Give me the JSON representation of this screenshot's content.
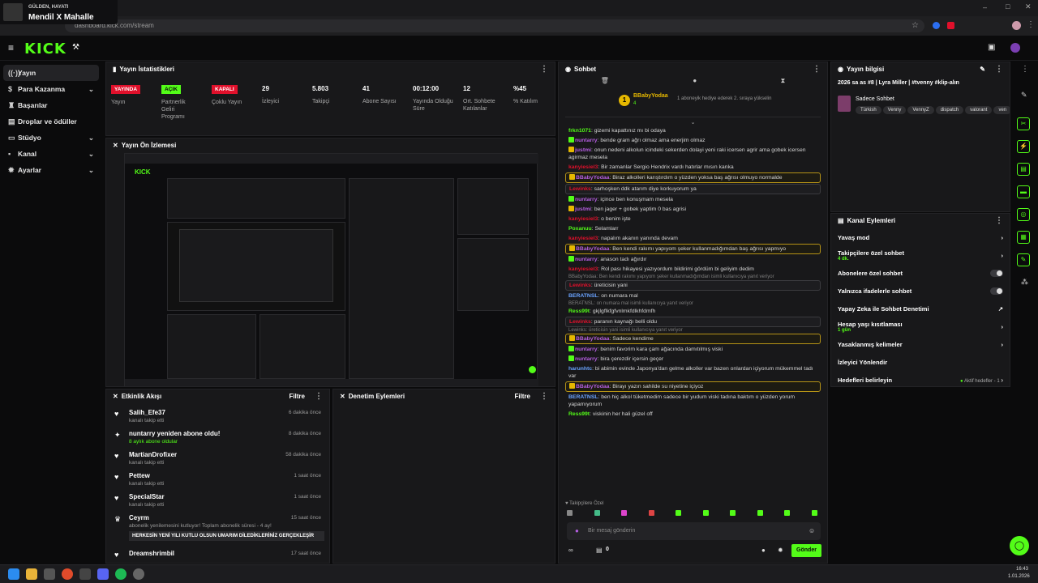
{
  "notification": {
    "title": "GÜLDEN, HAYATI",
    "subtitle": "Mendil X Mahalle"
  },
  "browser": {
    "url": "dashboard.kick.com/stream"
  },
  "app": {
    "logo": "KICK"
  },
  "sidebar": {
    "items": [
      {
        "label": "Yayın",
        "icon": "broadcast-icon",
        "active": true,
        "chevron": false
      },
      {
        "label": "Para Kazanma",
        "icon": "money-icon",
        "chevron": true
      },
      {
        "label": "Başarılar",
        "icon": "trophy-icon",
        "chevron": false
      },
      {
        "label": "Droplar ve ödüller",
        "icon": "gift-icon",
        "chevron": false
      },
      {
        "label": "Stüdyo",
        "icon": "studio-icon",
        "chevron": true
      },
      {
        "label": "Kanal",
        "icon": "user-icon",
        "chevron": true
      },
      {
        "label": "Ayarlar",
        "icon": "gear-icon",
        "chevron": true
      }
    ]
  },
  "stats": {
    "title": "Yayın İstatistikleri",
    "items": [
      {
        "value": "YAYINDA",
        "label": "Yayın",
        "badge": "red"
      },
      {
        "value": "AÇIK",
        "label": "Partnerlik Geliri Programı",
        "badge": "green"
      },
      {
        "value": "KAPALI",
        "label": "Çoklu Yayın",
        "badge": "red"
      },
      {
        "value": "29",
        "label": "İzleyici"
      },
      {
        "value": "5.803",
        "label": "Takipçi"
      },
      {
        "value": "41",
        "label": "Abone Sayısı"
      },
      {
        "value": "00:12:00",
        "label": "Yayında Olduğu Süre"
      },
      {
        "value": "12",
        "label": "Ort. Sohbete Katılanlar"
      },
      {
        "value": "%45",
        "label": "% Katılım"
      }
    ]
  },
  "preview": {
    "title": "Yayın Ön İzlemesi"
  },
  "activity": {
    "title": "Etkinlik Akışı",
    "filter": "Filtre",
    "items": [
      {
        "name": "Salih_Efe37",
        "sub": "kanalı takip etti",
        "time": "6 dakika önce",
        "icon": "heart-icon"
      },
      {
        "name": "nuntarry yeniden abone oldu!",
        "sub": "8 aylık abone oldular",
        "time": "8 dakika önce",
        "icon": "star-icon",
        "green": true
      },
      {
        "name": "MartianDrofixer",
        "sub": "kanalı takip etti",
        "time": "58 dakika önce",
        "icon": "heart-icon"
      },
      {
        "name": "Pettew",
        "sub": "kanalı takip etti",
        "time": "1 saat önce",
        "icon": "heart-icon"
      },
      {
        "name": "SpecialStar",
        "sub": "kanalı takip etti",
        "time": "1 saat önce",
        "icon": "heart-icon"
      },
      {
        "name": "Ceyrm",
        "sub": "abonelik yenilemesini kutluyor! Toplam abonelik süresi - 4 ay!",
        "time": "15 saat önce",
        "icon": "crown-icon",
        "message": "HERKESİN YENİ YILI KUTLU OLSUN UMARIM DİLEDİKLERİNİZ GERÇEKLEŞİR"
      }
    ],
    "cut_off": "Dreamshrimbil",
    "cut_time": "17 saat önce"
  },
  "moderation": {
    "title": "Denetim Eylemleri",
    "filter": "Filtre"
  },
  "chat": {
    "title": "Sohbet",
    "pinned": {
      "user": "BBabyYodaa",
      "count": "4",
      "text": "1 aboneyik hediye ederek 2. sıraya yükselin"
    },
    "messages": [
      {
        "user": "frkn1071",
        "color": "#53fc18",
        "text": "gizemi kapattınız mı bi odaya"
      },
      {
        "user": "nuntarry",
        "color": "#b45ee0",
        "text": "bende gram ağrı olmaz ama enerjim olmaz",
        "badge": "#53fc18"
      },
      {
        "user": "justmi",
        "color": "#b45ee0",
        "text": "onun nedeni alkolun icindeki sekerden dolayi yeni raki icersen agrir ama gobek icersen agirmaz mesela",
        "badge": "#e6b800"
      },
      {
        "user": "kanyiesiel3",
        "color": "#e0102b",
        "text": "Bir zamanlar Sergio Hendrix vardı hatırlar mısın kanka"
      },
      {
        "user": "BBabyYodaa",
        "color": "#b45ee0",
        "text": "Biraz alkolleri karıştırdım o yüzden yoksa baş ağrısı olmuyo normalde",
        "hl": true
      },
      {
        "user": "Lewinks",
        "color": "#e0102b",
        "text": "sarhoşken ddk atarım diye korkuyorum ya",
        "hlb": true
      },
      {
        "user": "nuntarry",
        "color": "#b45ee0",
        "text": "içince ben konuşmam mesela",
        "badge": "#53fc18"
      },
      {
        "user": "justmi",
        "color": "#b45ee0",
        "text": "ben jager + gobek yaptim 0 bas agrisi",
        "badge": "#e6b800"
      },
      {
        "user": "kanyiesiel3",
        "color": "#e0102b",
        "text": "o benim işte"
      },
      {
        "user": "Poxanuu",
        "color": "#53fc18",
        "text": "Selamlarr"
      },
      {
        "user": "kanyiesiel3",
        "color": "#e0102b",
        "text": "napalım akanın yanında devam"
      },
      {
        "user": "BBabyYodaa",
        "color": "#b45ee0",
        "text": "Ben kendi rakımı yapıyom şeker kullanmadığımdan baş ağrısı yapmıyo",
        "hl": true
      },
      {
        "user": "nuntarry",
        "color": "#b45ee0",
        "text": "anason tadı ağırdır",
        "badge": "#53fc18"
      },
      {
        "user": "kanyiesiel3",
        "color": "#e0102b",
        "text": "Rol pası hikayesi yazıyordum bildirimi gördüm bi geliyim dedim"
      },
      {
        "reply": "BBabyYodaa: Ben kendi rakımı yapıyom şeker kullanmadığımdan isimli kullanıcıya yanıt veriyor",
        "user": "Lewinks",
        "color": "#e0102b",
        "text": "üreticisin yani",
        "hlb": true
      },
      {
        "user": "BERATNSL",
        "color": "#6aa3ff",
        "text": "on numara mal"
      },
      {
        "reply": "BERATNSL: on numara mal isimli kullanıcıya yanıt veriyor",
        "user": "Ress99t",
        "color": "#53fc18",
        "text": "gkjlgflkfgfvnlmkfdlkhfdmfh"
      },
      {
        "user": "Lewinks",
        "color": "#e0102b",
        "text": "paranın kaynağı belli oldu",
        "hlb": true
      },
      {
        "reply": "Lewinks: üreticisin yani isimli kullanıcıya yanıt veriyor",
        "user": "BBabyYodaa",
        "color": "#b45ee0",
        "text": "Sadece kendime",
        "hl": true
      },
      {
        "user": "nuntarry",
        "color": "#b45ee0",
        "text": "benim favorim kara çam ağacında damıtılmış viski",
        "badge": "#53fc18"
      },
      {
        "user": "nuntarry",
        "color": "#b45ee0",
        "text": "bira çerezdir içersin geçer",
        "badge": "#53fc18"
      },
      {
        "user": "harunhtc",
        "color": "#6aa3ff",
        "text": "bi abimin evinde Japonya'dan gelme alkoller var bazen onlardan içiyorum mükemmel tadı var"
      },
      {
        "user": "BBabyYodaa",
        "color": "#b45ee0",
        "text": "Birayı yazın sahilde su niyetine içiyoz",
        "hl": true
      },
      {
        "user": "BERATNSL",
        "color": "#6aa3ff",
        "text": "ben hiç alkol tüketmedim sadece bir yudum viski tadına baktım o yüzden yorum yapamıyorum"
      },
      {
        "user": "Ress99t",
        "color": "#53fc18",
        "text": "viskinin her hali güzel off"
      }
    ],
    "followers_only": "Takipçilere Özel",
    "input_placeholder": "Bir mesaj gönderin",
    "send": "Gönder",
    "count": "0"
  },
  "stream_info": {
    "title": "Yayın bilgisi",
    "stream_title": "2026 sa as #8 | Lyra Miller | #tvenny #klip-alın",
    "category": "Sadece Sohbet",
    "tags": [
      "Türkish",
      "Venny",
      "VennyZ",
      "dispatch",
      "valorant",
      "ven"
    ]
  },
  "channel_actions": {
    "title": "Kanal Eylemleri",
    "items": [
      {
        "label": "Yavaş mod",
        "control": "chevron"
      },
      {
        "label": "Takipçilere özel sohbet",
        "sub": "4 dk.",
        "control": "chevron"
      },
      {
        "label": "Abonelere özel sohbet",
        "control": "toggle"
      },
      {
        "label": "Yalnızca ifadelerle sohbet",
        "control": "toggle"
      },
      {
        "label": "Yapay Zeka ile Sohbet Denetimi",
        "control": "external"
      },
      {
        "label": "Hesap yaşı kısıtlaması",
        "sub": "1 gün",
        "control": "chevron"
      },
      {
        "label": "Yasaklanmış kelimeler",
        "control": "chevron"
      },
      {
        "label": "İzleyici Yönlendir",
        "control": "none"
      },
      {
        "label": "Hedefleri belirleyin",
        "control": "chevron",
        "status": "Aktif hedefler - 1"
      }
    ]
  },
  "taskbar": {
    "time": "16:43",
    "date": "1.01.2026"
  },
  "colors": {
    "accent": "#53fc18",
    "bg": "#0b0b0c",
    "panel": "#18181a",
    "live": "#e0102b"
  }
}
